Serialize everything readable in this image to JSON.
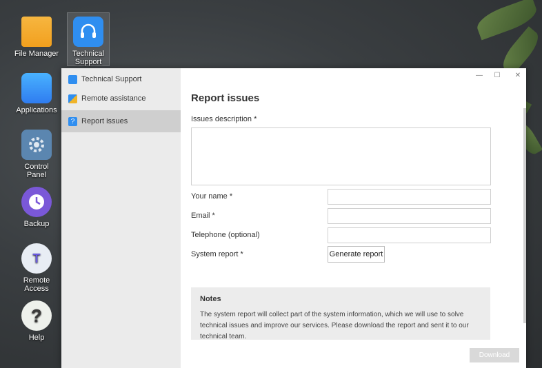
{
  "desktop": {
    "icons": [
      {
        "label_line1": "File Manager",
        "label_line2": "",
        "icon": "folder-icon",
        "color": "#f5a623"
      },
      {
        "label_line1": "Technical",
        "label_line2": "Support",
        "icon": "headset-icon",
        "color": "#2f8ef0"
      },
      {
        "label_line1": "Applications",
        "label_line2": "",
        "icon": "shopping-bag-icon",
        "color": "#3aa0ff"
      },
      {
        "label_line1": "Control",
        "label_line2": "Panel",
        "icon": "gear-icon",
        "color": "#5b86b0"
      },
      {
        "label_line1": "Backup",
        "label_line2": "",
        "icon": "clock-icon",
        "color": "#7a58d8"
      },
      {
        "label_line1": "Remote",
        "label_line2": "Access",
        "icon": "cloud-icon",
        "color": "#e8edf4"
      },
      {
        "label_line1": "Help",
        "label_line2": "",
        "icon": "help-icon",
        "color": "#e9efe6"
      }
    ]
  },
  "window": {
    "nav": [
      {
        "label": "Technical Support",
        "icon": "headset-icon",
        "color": "#2f8ef0"
      },
      {
        "label": "Remote assistance",
        "icon": "remote-assistance-icon",
        "color": "#2f8ef0"
      },
      {
        "label": "Report issues",
        "icon": "question-icon",
        "color": "#2f8ef0"
      }
    ],
    "controls": {
      "minimize": "—",
      "maximize": "☐",
      "close": "✕"
    },
    "report": {
      "title": "Report issues",
      "issues_label": "Issues description *",
      "name_label": "Your name *",
      "email_label": "Email *",
      "phone_label": "Telephone (optional)",
      "system_report_label": "System report *",
      "generate_button": "Generate report",
      "notes_title": "Notes",
      "notes_body": "The system report will collect part of the system information, which we will use to solve technical issues and improve our services. Please download the report and sent it to our technical team.",
      "download_button": "Download"
    }
  }
}
